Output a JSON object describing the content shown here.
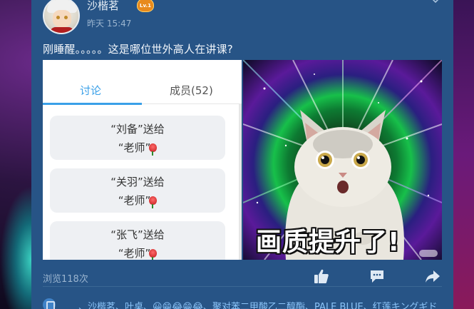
{
  "post": {
    "username": "沙楷茗",
    "level_badge": "Lv.1",
    "timestamp": "昨天 15:47",
    "text": "刚睡醒。。。。。这是哪位世外高人在讲课?",
    "views": "浏览118次",
    "likes_text": "、沙楷茗、叶桌、😀😁😂😁😂、聚对苯二甲酸乙二醇酯、PALE BLUE、红莲キングギド"
  },
  "image_left": {
    "tab_discuss": "讨论",
    "tab_members": "成员(52)",
    "gifts": [
      {
        "line1": "“刘备”送给",
        "line2": "“老师”"
      },
      {
        "line1": "“关羽”送给",
        "line2": "“老师”"
      },
      {
        "line1": "“张飞”送给",
        "line2": "“老师”"
      }
    ]
  },
  "image_right": {
    "caption": "画质提升了!"
  },
  "icons": {
    "like": "thumbs-up-icon",
    "comment": "comment-icon",
    "share": "share-icon",
    "chevron": "chevron-down-icon"
  }
}
